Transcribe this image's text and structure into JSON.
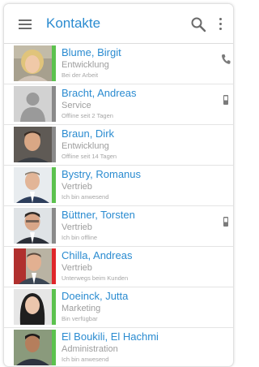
{
  "app": {
    "title": "Kontakte"
  },
  "icons": {
    "menu": "hamburger-menu-icon",
    "search": "search-icon",
    "more": "more-vertical-icon"
  },
  "colors": {
    "accent": "#2a8bd0",
    "available": "#5cc24e",
    "offline": "#8a8a8a",
    "busy": "#e0262a"
  },
  "contacts": [
    {
      "name": "Blume, Birgit",
      "department": "Entwicklung",
      "status_text": "Bei der Arbeit",
      "status": "available",
      "status_color": "#5cc24e",
      "action_icon": "phone-icon"
    },
    {
      "name": "Bracht, Andreas",
      "department": "Service",
      "status_text": "Offline seit 2 Tagen",
      "status": "offline",
      "status_color": "#8a8a8a",
      "action_icon": "mobile-phone-icon"
    },
    {
      "name": "Braun, Dirk",
      "department": "Entwicklung",
      "status_text": "Offline seit 14 Tagen",
      "status": "offline",
      "status_color": "#8a8a8a",
      "action_icon": ""
    },
    {
      "name": "Bystry, Romanus",
      "department": "Vertrieb",
      "status_text": "Ich bin anwesend",
      "status": "available",
      "status_color": "#5cc24e",
      "action_icon": ""
    },
    {
      "name": "Büttner, Torsten",
      "department": "Vertrieb",
      "status_text": "Ich bin offline",
      "status": "offline",
      "status_color": "#8a8a8a",
      "action_icon": "mobile-phone-icon"
    },
    {
      "name": "Chilla, Andreas",
      "department": "Vertrieb",
      "status_text": "Unterwegs beim Kunden",
      "status": "busy",
      "status_color": "#e0262a",
      "action_icon": ""
    },
    {
      "name": "Doeinck, Jutta",
      "department": "Marketing",
      "status_text": "Bin verfügbar",
      "status": "available",
      "status_color": "#5cc24e",
      "action_icon": ""
    },
    {
      "name": "El Boukili, El Hachmi",
      "department": "Administration",
      "status_text": "Ich bin anwesend",
      "status": "available",
      "status_color": "#5cc24e",
      "action_icon": ""
    }
  ]
}
